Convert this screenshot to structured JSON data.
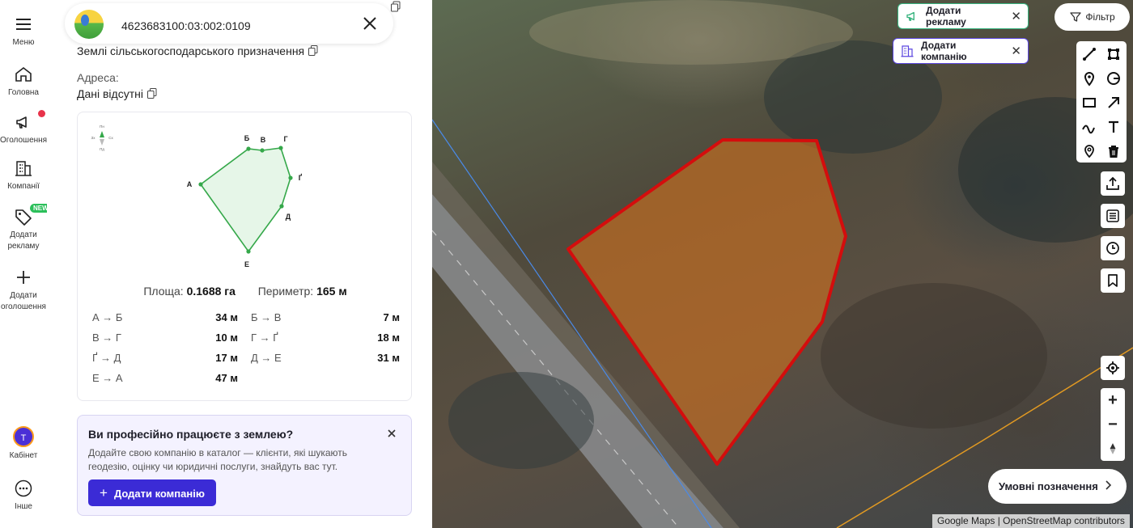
{
  "nav": {
    "menu": "Меню",
    "home": "Головна",
    "ads": "Оголошення",
    "companies": "Компанії",
    "add_ad": "Додати рекламу",
    "new_badge": "NEW",
    "add_listing": "Додати оголошення",
    "cabinet": "Кабінет",
    "avatar_letter": "Т",
    "more": "Інше"
  },
  "parcel": {
    "cadastral_number": "4623683100:03:002:0109",
    "land_type": "Землі сільськогосподарського призначення",
    "address_label": "Адреса:",
    "address_value": "Дані відсутні"
  },
  "plan": {
    "compass": {
      "n": "Пн",
      "s": "Пд",
      "w": "Зх",
      "e": "Сх"
    },
    "vertices": [
      "А",
      "Б",
      "В",
      "Г",
      "Ґ",
      "Д",
      "Е"
    ],
    "area_label": "Площа:",
    "area_value": "0.1688 га",
    "perimeter_label": "Периметр:",
    "perimeter_value": "165 м",
    "segments": [
      {
        "label": "А → Б",
        "value": "34 м"
      },
      {
        "label": "Б → В",
        "value": "7 м"
      },
      {
        "label": "В → Г",
        "value": "10 м"
      },
      {
        "label": "Г → Ґ",
        "value": "18 м"
      },
      {
        "label": "Ґ → Д",
        "value": "17 м"
      },
      {
        "label": "Д → Е",
        "value": "31 м"
      },
      {
        "label": "Е → А",
        "value": "47 м"
      }
    ]
  },
  "promo": {
    "title": "Ви професійно працюєте з землею?",
    "text": "Додайте свою компанію в каталог — клієнти, які шукають геодезію, оцінку чи юридичні послуги, знайдуть вас тут.",
    "button": "Додати компанію"
  },
  "map": {
    "add_ad_pill": "Додати рекламу",
    "add_company_pill": "Додати компанію",
    "filter": "Фільтр",
    "legend": "Умовні позначення",
    "attribution": "Google Maps | OpenStreetMap contributors"
  },
  "colors": {
    "accent": "#3b2bd6",
    "parcel_stroke": "#d40d0d",
    "parcel_fill": "#d8731e",
    "plan_stroke": "#35a84a",
    "ads_pill_border": "#36b37e",
    "company_pill_border": "#5b46e0",
    "notification_dot": "#e8334a",
    "new_badge": "#2bbf5a"
  }
}
